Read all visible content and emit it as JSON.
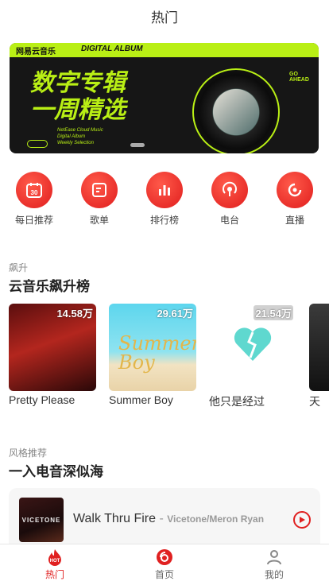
{
  "header": {
    "title": "热门"
  },
  "banner": {
    "brand": "网易云音乐",
    "album_tag": "DIGITAL ALBUM",
    "headline_1": "数字专辑",
    "headline_2": "一周精选",
    "sub_1": "NetEase Cloud Music",
    "sub_2": "Digital Album",
    "sub_3": "Weekly Selection",
    "go_ahead": "GO AHEAD"
  },
  "quick_entries": [
    {
      "label": "每日推荐",
      "icon": "calendar-icon",
      "badge": "30"
    },
    {
      "label": "歌单",
      "icon": "playlist-icon"
    },
    {
      "label": "排行榜",
      "icon": "chart-bars-icon"
    },
    {
      "label": "电台",
      "icon": "radio-icon"
    },
    {
      "label": "直播",
      "icon": "live-icon"
    }
  ],
  "rising": {
    "subtitle": "飙升",
    "title": "云音乐飙升榜",
    "items": [
      {
        "name": "Pretty Please",
        "count": "14.58万"
      },
      {
        "name": "Summer Boy",
        "count": "29.61万",
        "cover_text": "Summer Boy"
      },
      {
        "name": "他只是经过",
        "count": "21.54万"
      },
      {
        "name": "天",
        "count": ""
      }
    ]
  },
  "style": {
    "subtitle": "风格推荐",
    "title": "一入电音深似海",
    "song": {
      "title": "Walk Thru Fire",
      "separator": " - ",
      "artist": "Vicetone/Meron Ryan",
      "cover_text": "VICETONE"
    }
  },
  "tabbar": [
    {
      "label": "热门",
      "icon": "flame-hot-icon",
      "active": true
    },
    {
      "label": "首页",
      "icon": "netease-music-icon",
      "active": false
    },
    {
      "label": "我的",
      "icon": "user-icon",
      "active": false
    }
  ],
  "colors": {
    "accent": "#e02020",
    "banner_green": "#b9ef15"
  }
}
